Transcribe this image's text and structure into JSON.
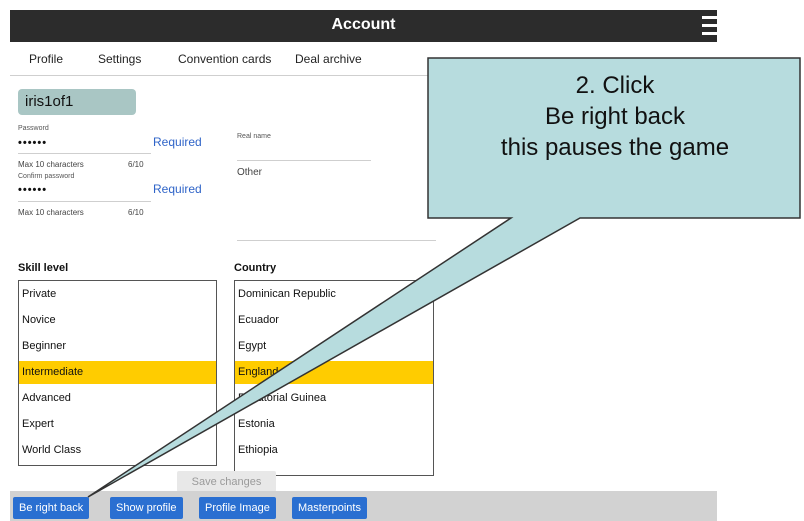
{
  "header": {
    "title": "Account"
  },
  "tabs": [
    "Profile",
    "Settings",
    "Convention cards",
    "Deal archive"
  ],
  "profile": {
    "username": "iris1of1",
    "password_label": "Password",
    "password_value": "••••••",
    "password_status": "Required",
    "password_hint": "Max 10 characters",
    "password_count": "6/10",
    "confirm_label": "Confirm password",
    "confirm_value": "••••••",
    "confirm_status": "Required",
    "confirm_hint": "Max 10 characters",
    "confirm_count": "6/10",
    "realname_label": "Real name",
    "other_label": "Other"
  },
  "skill": {
    "label": "Skill level",
    "items": [
      "Private",
      "Novice",
      "Beginner",
      "Intermediate",
      "Advanced",
      "Expert",
      "World Class"
    ],
    "selected": "Intermediate"
  },
  "country": {
    "label": "Country",
    "items": [
      "Dominican Republic",
      "Ecuador",
      "Egypt",
      "England",
      "Equatorial Guinea",
      "Estonia",
      "Ethiopia"
    ],
    "selected": "England"
  },
  "save_label": "Save changes",
  "bottom_buttons": [
    "Be right back",
    "Show profile",
    "Profile Image",
    "Masterpoints"
  ],
  "callout": {
    "lines": [
      "2. Click",
      "Be right back",
      "this pauses the game"
    ],
    "fill_color": "#b7dcde",
    "border_color": "#333333"
  },
  "colors": {
    "selection": "#ffcc00",
    "button_blue": "#2a6fd1",
    "titlebar": "#2c2c2c",
    "required_text": "#2f64c8"
  }
}
